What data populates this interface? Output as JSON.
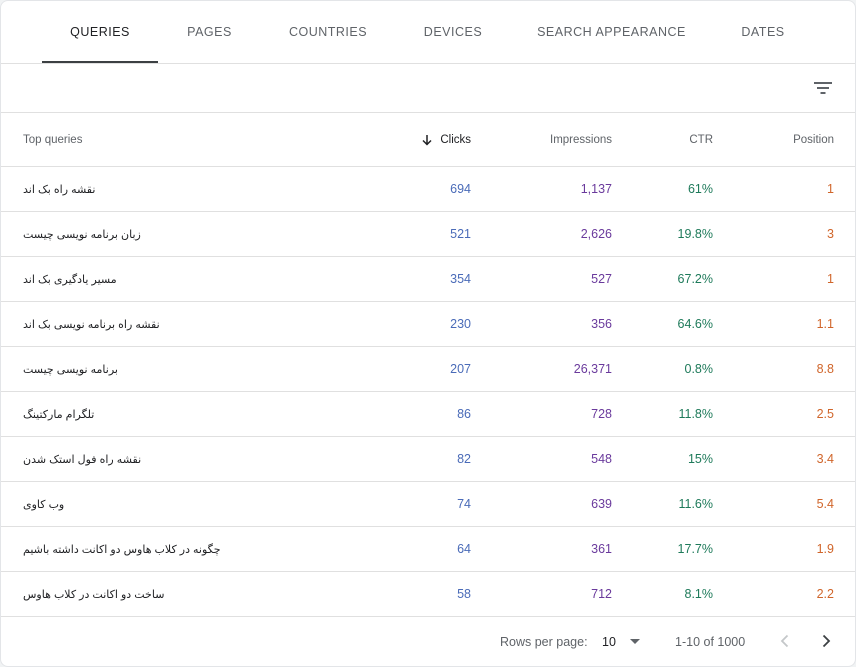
{
  "tabs": [
    {
      "label": "QUERIES",
      "active": true
    },
    {
      "label": "PAGES",
      "active": false
    },
    {
      "label": "COUNTRIES",
      "active": false
    },
    {
      "label": "DEVICES",
      "active": false
    },
    {
      "label": "SEARCH APPEARANCE",
      "active": false
    },
    {
      "label": "DATES",
      "active": false
    }
  ],
  "filter": {
    "icon": "filter-icon"
  },
  "table": {
    "headers": {
      "query": "Top queries",
      "clicks": "Clicks",
      "impressions": "Impressions",
      "ctr": "CTR",
      "position": "Position"
    },
    "sort": {
      "column": "clicks",
      "direction": "descending",
      "icon": "arrow-down-icon"
    },
    "rows": [
      {
        "query": "نقشه راه بک اند",
        "clicks": "694",
        "impressions": "1,137",
        "ctr": "61%",
        "position": "1"
      },
      {
        "query": "زبان برنامه نویسی چیست",
        "clicks": "521",
        "impressions": "2,626",
        "ctr": "19.8%",
        "position": "3"
      },
      {
        "query": "مسیر یادگیری بک اند",
        "clicks": "354",
        "impressions": "527",
        "ctr": "67.2%",
        "position": "1"
      },
      {
        "query": "نقشه راه برنامه نویسی بک اند",
        "clicks": "230",
        "impressions": "356",
        "ctr": "64.6%",
        "position": "1.1"
      },
      {
        "query": "برنامه نویسی چیست",
        "clicks": "207",
        "impressions": "26,371",
        "ctr": "0.8%",
        "position": "8.8"
      },
      {
        "query": "تلگرام مارکتینگ",
        "clicks": "86",
        "impressions": "728",
        "ctr": "11.8%",
        "position": "2.5"
      },
      {
        "query": "نقشه راه فول استک شدن",
        "clicks": "82",
        "impressions": "548",
        "ctr": "15%",
        "position": "3.4"
      },
      {
        "query": "وب کاوی",
        "clicks": "74",
        "impressions": "639",
        "ctr": "11.6%",
        "position": "5.4"
      },
      {
        "query": "چگونه در کلاب هاوس دو اکانت داشته باشیم",
        "clicks": "64",
        "impressions": "361",
        "ctr": "17.7%",
        "position": "1.9"
      },
      {
        "query": "ساخت دو اکانت در کلاب هاوس",
        "clicks": "58",
        "impressions": "712",
        "ctr": "8.1%",
        "position": "2.2"
      }
    ]
  },
  "pagination": {
    "rows_label": "Rows per page:",
    "rows_value": "10",
    "range": "1-10 of 1000",
    "prev_icon": "chevron-left-icon",
    "next_icon": "chevron-right-icon"
  },
  "colors": {
    "clicks": "#4a6bb8",
    "impressions": "#6a3a9c",
    "ctr": "#1e7a5a",
    "position": "#d0652a",
    "tab_indicator": "#3c4043"
  }
}
